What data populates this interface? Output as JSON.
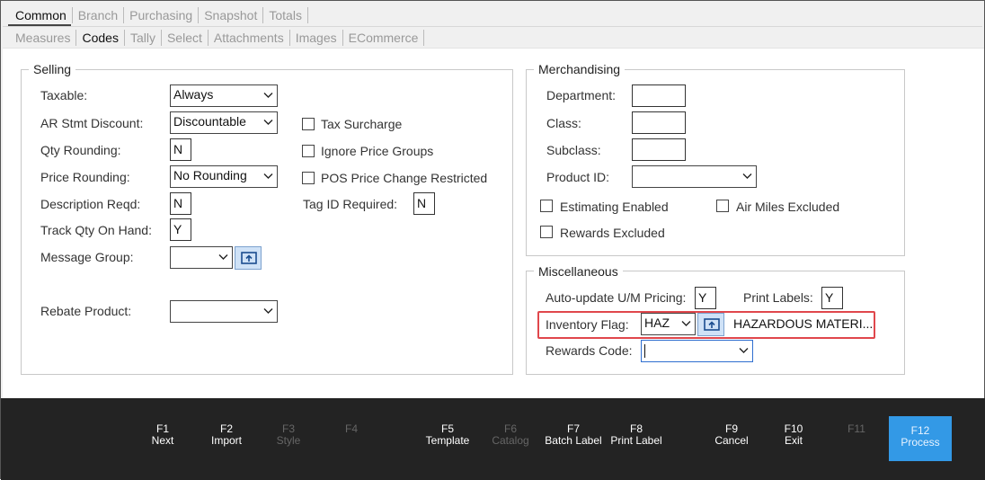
{
  "tabs_primary": [
    {
      "label": "Common",
      "active": true
    },
    {
      "label": "Branch",
      "active": false
    },
    {
      "label": "Purchasing",
      "active": false
    },
    {
      "label": "Snapshot",
      "active": false
    },
    {
      "label": "Totals",
      "active": false
    }
  ],
  "tabs_secondary": [
    {
      "label": "Measures",
      "active": false
    },
    {
      "label": "Codes",
      "active": true
    },
    {
      "label": "Tally",
      "active": false
    },
    {
      "label": "Select",
      "active": false
    },
    {
      "label": "Attachments",
      "active": false
    },
    {
      "label": "Images",
      "active": false
    },
    {
      "label": "ECommerce",
      "active": false
    }
  ],
  "selling": {
    "title": "Selling",
    "taxable": {
      "label": "Taxable:",
      "value": "Always"
    },
    "ar_stmt_discount": {
      "label": "AR Stmt Discount:",
      "value": "Discountable"
    },
    "qty_rounding": {
      "label": "Qty Rounding:",
      "value": "N"
    },
    "price_rounding": {
      "label": "Price Rounding:",
      "value": "No Rounding"
    },
    "description_reqd": {
      "label": "Description Reqd:",
      "value": "N"
    },
    "track_qty": {
      "label": "Track Qty On Hand:",
      "value": "Y"
    },
    "message_group": {
      "label": "Message Group:",
      "value": ""
    },
    "rebate_product": {
      "label": "Rebate Product:",
      "value": ""
    },
    "tax_surcharge": {
      "label": "Tax Surcharge",
      "checked": false
    },
    "ignore_price_groups": {
      "label": "Ignore Price Groups",
      "checked": false
    },
    "pos_price_change": {
      "label": "POS Price Change Restricted",
      "checked": false
    },
    "tag_id_required": {
      "label": "Tag ID Required:",
      "value": "N"
    }
  },
  "merchandising": {
    "title": "Merchandising",
    "department": {
      "label": "Department:",
      "value": ""
    },
    "class": {
      "label": "Class:",
      "value": ""
    },
    "subclass": {
      "label": "Subclass:",
      "value": ""
    },
    "product_id": {
      "label": "Product ID:",
      "value": ""
    },
    "estimating_enabled": {
      "label": "Estimating Enabled",
      "checked": false
    },
    "air_miles_excluded": {
      "label": "Air Miles Excluded",
      "checked": false
    },
    "rewards_excluded": {
      "label": "Rewards Excluded",
      "checked": false
    }
  },
  "miscellaneous": {
    "title": "Miscellaneous",
    "auto_update": {
      "label": "Auto-update U/M Pricing:",
      "value": "Y"
    },
    "print_labels": {
      "label": "Print Labels:",
      "value": "Y"
    },
    "inventory_flag": {
      "label": "Inventory Flag:",
      "value": "HAZ",
      "description": "HAZARDOUS MATERI..."
    },
    "rewards_code": {
      "label": "Rewards Code:",
      "value": ""
    }
  },
  "function_keys": [
    {
      "key": "F1",
      "label": "Next",
      "enabled": true
    },
    {
      "key": "F2",
      "label": "Import",
      "enabled": true
    },
    {
      "key": "F3",
      "label": "Style",
      "enabled": false
    },
    {
      "key": "F4",
      "label": "",
      "enabled": false
    },
    {
      "key": "F5",
      "label": "Template",
      "enabled": true
    },
    {
      "key": "F6",
      "label": "Catalog",
      "enabled": false
    },
    {
      "key": "F7",
      "label": "Batch Label",
      "enabled": true
    },
    {
      "key": "F8",
      "label": "Print Label",
      "enabled": true
    },
    {
      "key": "F9",
      "label": "Cancel",
      "enabled": true
    },
    {
      "key": "F10",
      "label": "Exit",
      "enabled": true
    },
    {
      "key": "F11",
      "label": "",
      "enabled": false
    },
    {
      "key": "F12",
      "label": "Process",
      "enabled": true
    }
  ],
  "colors": {
    "highlight": "#e0474c",
    "process_button": "#3399e6",
    "footer_bg": "#232323",
    "pick_button": "#cfe2f7"
  },
  "icons": {
    "picker": "pick-list-icon",
    "dropdown": "chevron-down-icon"
  }
}
